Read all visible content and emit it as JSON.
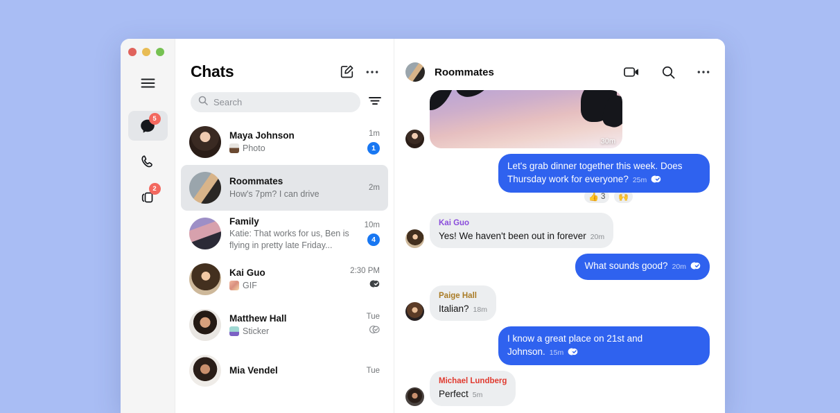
{
  "desktop": {
    "background_color": "#a9bdf4"
  },
  "window": {
    "traffic_lights": [
      {
        "name": "close",
        "color": "#e0635c"
      },
      {
        "name": "minimize",
        "color": "#e8bc54"
      },
      {
        "name": "maximize",
        "color": "#76c152"
      }
    ]
  },
  "rail": {
    "items": [
      {
        "icon": "hamburger-menu-icon",
        "badge": null,
        "active": false
      },
      {
        "icon": "chat-bubble-icon",
        "badge": "5",
        "active": true
      },
      {
        "icon": "phone-icon",
        "badge": null,
        "active": false
      },
      {
        "icon": "stories-icon",
        "badge": "2",
        "active": false
      }
    ],
    "badge_color": "#f3685f"
  },
  "chat_list": {
    "title": "Chats",
    "compose_icon": "compose-pencil-icon",
    "more_icon": "ellipsis-icon",
    "search": {
      "placeholder": "Search",
      "value": "",
      "icon": "search-icon"
    },
    "filter_icon": "filter-icon",
    "conversations": [
      {
        "name": "Maya Johnson",
        "preview": "Photo",
        "has_thumb": true,
        "time": "1m",
        "unread": "1",
        "selected": false,
        "receipt": null
      },
      {
        "name": "Roommates",
        "preview": "How's 7pm? I can drive",
        "has_thumb": false,
        "time": "2m",
        "unread": null,
        "selected": true,
        "receipt": null
      },
      {
        "name": "Family",
        "preview": "Katie: That works for us, Ben is flying in pretty late Friday...",
        "has_thumb": false,
        "time": "10m",
        "unread": "4",
        "selected": false,
        "receipt": null
      },
      {
        "name": "Kai Guo",
        "preview": "GIF",
        "has_thumb": true,
        "time": "2:30 PM",
        "unread": null,
        "selected": false,
        "receipt": "read"
      },
      {
        "name": "Matthew Hall",
        "preview": "Sticker",
        "has_thumb": true,
        "time": "Tue",
        "unread": null,
        "selected": false,
        "receipt": "delivered"
      },
      {
        "name": "Mia Vendel",
        "preview": "",
        "has_thumb": false,
        "time": "Tue",
        "unread": null,
        "selected": false,
        "receipt": null
      }
    ]
  },
  "thread": {
    "title": "Roommates",
    "video_icon": "video-camera-icon",
    "search_icon": "search-icon",
    "more_icon": "ellipsis-icon",
    "bubble_out_color": "#2f62ef",
    "bubble_in_color": "#eceef0",
    "messages": [
      {
        "type": "photo",
        "direction": "in",
        "time": "30m"
      },
      {
        "type": "text",
        "direction": "out",
        "text": "Let's grab dinner together this week. Does Thursday work for everyone?",
        "time": "25m",
        "receipt": "read",
        "reactions": [
          {
            "emoji": "👍",
            "count": "3"
          },
          {
            "emoji": "🙌",
            "count": ""
          }
        ]
      },
      {
        "type": "text",
        "direction": "in",
        "sender": "Kai Guo",
        "sender_color": "#8a4ddb",
        "text": "Yes! We haven't been out in forever",
        "time": "20m"
      },
      {
        "type": "text",
        "direction": "out",
        "text": "What sounds good?",
        "time": "20m",
        "receipt": "read"
      },
      {
        "type": "text",
        "direction": "in",
        "sender": "Paige Hall",
        "sender_color": "#a97b25",
        "text": "Italian?",
        "time": "18m"
      },
      {
        "type": "text",
        "direction": "out",
        "text": "I know a great place on 21st and Johnson.",
        "time": "15m",
        "receipt": "read"
      },
      {
        "type": "text",
        "direction": "in",
        "sender": "Michael Lundberg",
        "sender_color": "#e03a2f",
        "text": "Perfect",
        "time": "5m"
      }
    ]
  }
}
